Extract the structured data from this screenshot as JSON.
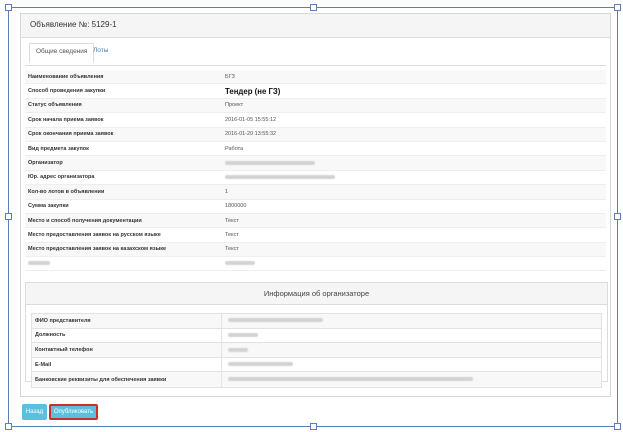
{
  "header": {
    "title": "Объявление №: 5129-1"
  },
  "tabs": [
    {
      "label": "Общие сведения",
      "active": true
    },
    {
      "label": "Лоты",
      "active": false
    }
  ],
  "details": [
    {
      "label": "Наименование объявления",
      "value": "БГЗ"
    },
    {
      "label": "Способ проведения закупки",
      "value": "Тендер (не ГЗ)"
    },
    {
      "label": "Статус объявления",
      "value": "Проект"
    },
    {
      "label": "Срок начала приема заявок",
      "value": "2016-01-05 15:55:12"
    },
    {
      "label": "Срок окончания приема заявок",
      "value": "2016-01-20 13:55:32"
    },
    {
      "label": "Вид предмета закупок",
      "value": "Работа"
    },
    {
      "label": "Организатор",
      "value": ""
    },
    {
      "label": "Юр. адрес организатора",
      "value": ""
    },
    {
      "label": "Кол-во лотов в объявлении",
      "value": "1"
    },
    {
      "label": "Сумма закупки",
      "value": "1800000"
    },
    {
      "label": "Место и способ получения документации",
      "value": "Текст"
    },
    {
      "label": "Место предоставления заявок на русском языке",
      "value": "Текст"
    },
    {
      "label": "Место предоставления заявок на казахском языке",
      "value": "Текст"
    },
    {
      "label": "",
      "value": ""
    }
  ],
  "organizer": {
    "title": "Информация об организаторе",
    "rows": [
      {
        "label": "ФИО представителя",
        "value": ""
      },
      {
        "label": "Должность",
        "value": ""
      },
      {
        "label": "Контактный телефон",
        "value": ""
      },
      {
        "label": "E-Mail",
        "value": ""
      },
      {
        "label": "Банковские реквизиты для обеспечения заявки",
        "value": ""
      }
    ]
  },
  "buttons": {
    "back_label": "Назад",
    "publish_label": "Опубликовать"
  },
  "colors": {
    "button": "#5bc0de",
    "highlight_border": "#c9302c",
    "link": "#3b7cc0"
  }
}
